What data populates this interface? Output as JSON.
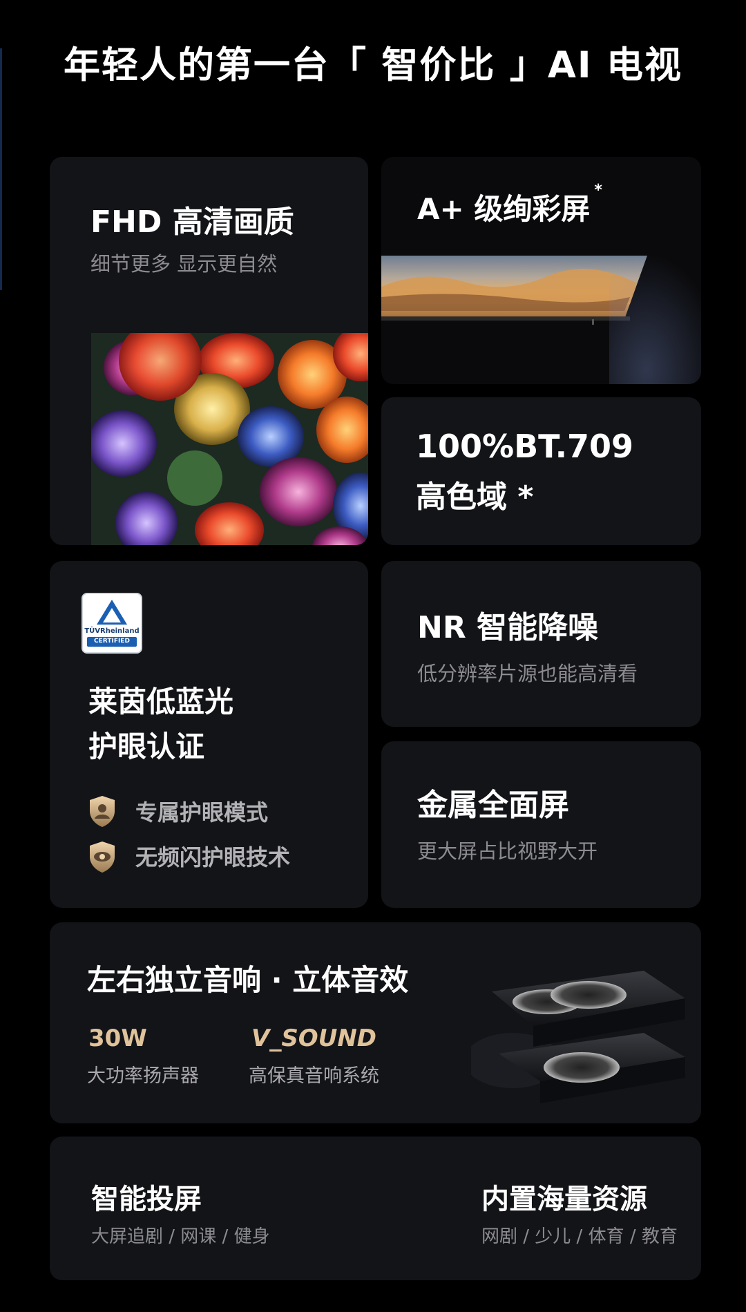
{
  "header": {
    "title": "年轻人的第一台「 智价比 」AI 电视"
  },
  "cards": {
    "fhd": {
      "title": "FHD 高清画质",
      "subtitle": "细节更多 显示更自然"
    },
    "a_plus": {
      "title": "A+ 级绚彩屏",
      "mark": "*"
    },
    "bt709": {
      "line1": "100%BT.709",
      "line2": "高色域 *"
    },
    "tuv": {
      "badge_brand": "TÜVRheinland",
      "badge_label": "CERTIFIED",
      "title_line1": "莱茵低蓝光",
      "title_line2": "护眼认证",
      "features": [
        "专属护眼模式",
        "无频闪护眼技术"
      ]
    },
    "nr": {
      "title": "NR 智能降噪",
      "subtitle": "低分辨率片源也能高清看"
    },
    "metal": {
      "title": "金属全面屏",
      "subtitle": "更大屏占比视野大开"
    },
    "audio": {
      "title": "左右独立音响 · 立体音效",
      "power_value": "30W",
      "power_label": "大功率扬声器",
      "vsound_logo": "V_SOUND",
      "vsound_label": "高保真音响系统"
    },
    "cast": {
      "title": "智能投屏",
      "subtitle": "大屏追剧 / 网课 / 健身"
    },
    "content": {
      "title": "内置海量资源",
      "subtitle": "网剧 / 少儿 / 体育 / 教育"
    }
  },
  "colors": {
    "accent_gold": "#e0c39a",
    "card_bg": "#131418",
    "muted_text": "#8c8c90"
  }
}
